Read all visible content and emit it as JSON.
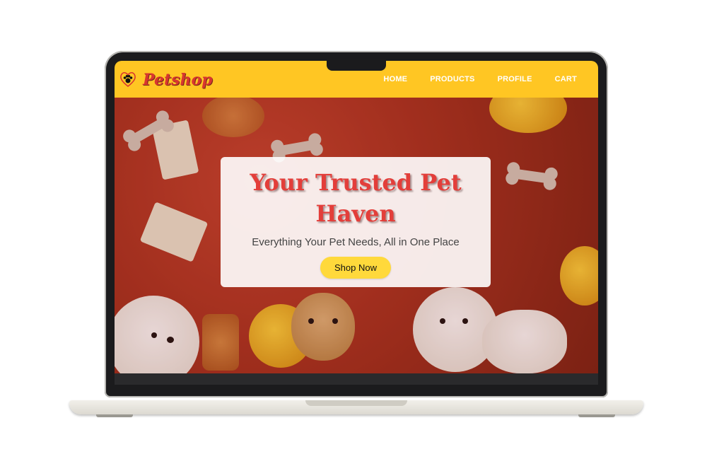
{
  "brand": {
    "name": "Petshop",
    "icon": "paw-heart-icon"
  },
  "nav": {
    "items": [
      {
        "label": "HOME"
      },
      {
        "label": "PRODUCTS"
      },
      {
        "label": "PROFILE"
      },
      {
        "label": "CART"
      }
    ]
  },
  "hero": {
    "title": "Your Trusted Pet Haven",
    "subtitle": "Everything Your Pet Needs, All in One Place",
    "cta_label": "Shop Now"
  },
  "colors": {
    "navbar": "#ffc623",
    "brand_red": "#e33e3a",
    "cta": "#ffd93b"
  }
}
